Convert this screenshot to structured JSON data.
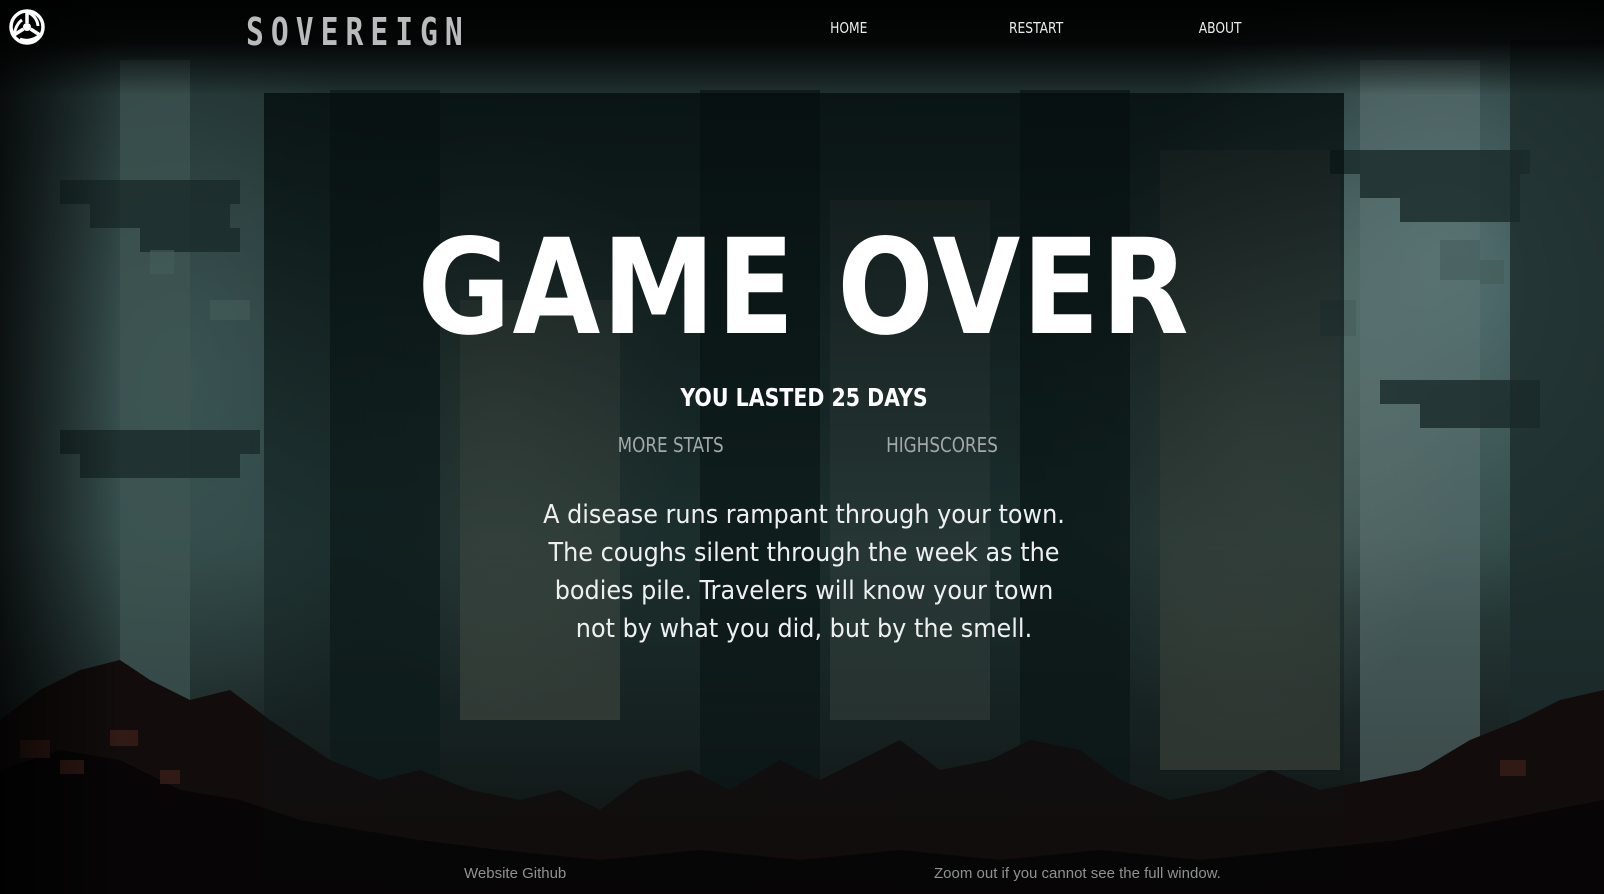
{
  "nav": {
    "logo_icon": "triskelion-logo-icon",
    "brand": "SOVEREIGN",
    "links": [
      {
        "label": "HOME"
      },
      {
        "label": "RESTART"
      },
      {
        "label": "ABOUT"
      }
    ]
  },
  "game_over": {
    "title": "GAME OVER",
    "days_lasted": "YOU LASTED 25 DAYS",
    "more_stats_label": "MORE STATS",
    "highscores_label": "HIGHSCORES",
    "story": "A disease runs rampant through your town. The coughs silent through the week as the bodies pile. Travelers will know your town not by what you did, but by the smell."
  },
  "footer": {
    "github_label": "Website Github",
    "note": "Zoom out if you cannot see the full window."
  },
  "colors": {
    "text": "#ffffff",
    "muted": "#a3a8a8",
    "brand": "#b9bcbc",
    "footer": "#8e9292",
    "background": "#0a1010"
  }
}
